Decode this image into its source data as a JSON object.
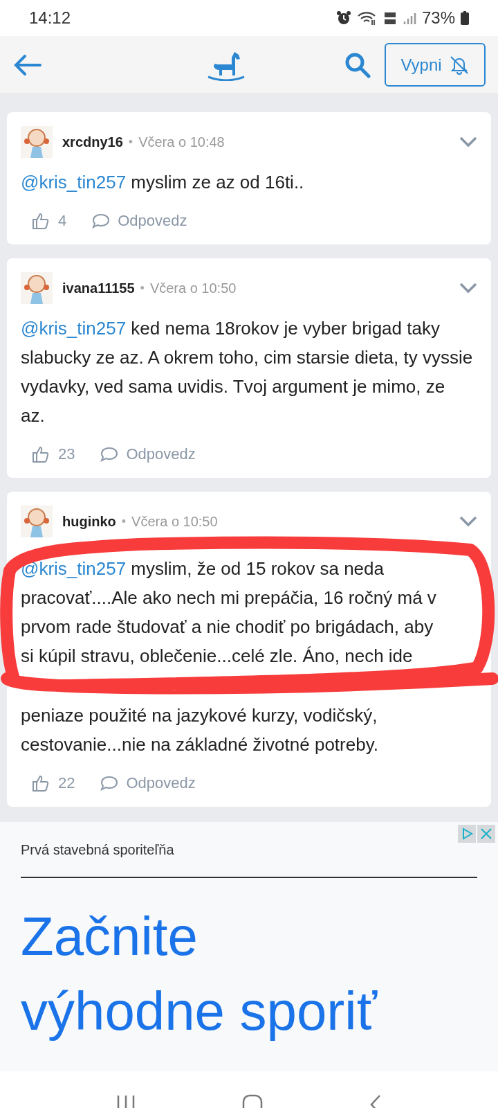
{
  "status_bar": {
    "time": "14:12",
    "battery": "73%"
  },
  "header": {
    "mute_button": "Vypni"
  },
  "comments": [
    {
      "author": "xrcdny16",
      "separator": "•",
      "time": "Včera o 10:48",
      "mention": "@kris_tin257",
      "text": "myslim ze az od 16ti..",
      "likes": "4",
      "reply": "Odpovedz"
    },
    {
      "author": "ivana11155",
      "separator": "•",
      "time": "Včera o 10:50",
      "mention": "@kris_tin257",
      "text": "ked nema 18rokov je vyber brigad taky slabucky ze az. A okrem toho, cim starsie dieta, ty vyssie vydavky, ved sama uvidis. Tvoj argument je mimo, ze az.",
      "likes": "23",
      "reply": "Odpovedz"
    },
    {
      "author": "huginko",
      "separator": "•",
      "time": "Včera o 10:50",
      "mention": "@kris_tin257",
      "lines_above": [
        "myslim, že od 15 rokov sa neda",
        "pracovať....Ale ako nech mi prepáčia, 16 ročný má v",
        "prvom rade študovať a nie chodiť po brigádach, aby",
        "si kúpil stravu, oblečenie...celé zle. Áno, nech ide"
      ],
      "lines_below": [
        "peniaze použité na jazykové kurzy, vodičský,",
        "cestovanie...nie na základné životné potreby."
      ],
      "likes": "22",
      "reply": "Odpovedz"
    }
  ],
  "ad": {
    "advertiser": "Prvá stavebná sporiteľňa",
    "headline": [
      "Začnite",
      "výhodne sporiť"
    ]
  }
}
